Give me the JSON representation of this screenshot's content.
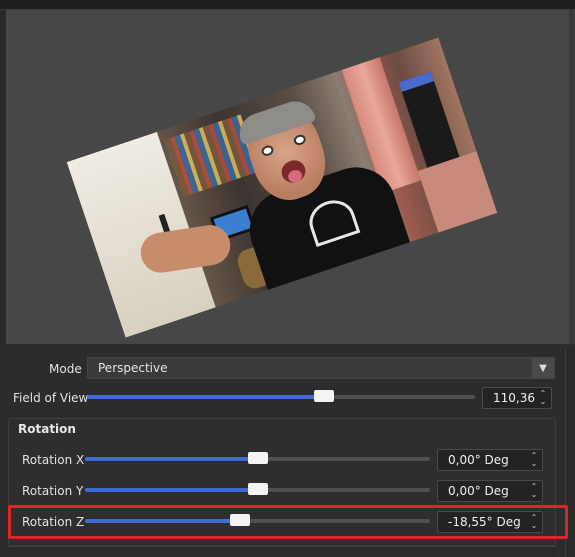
{
  "preview": {
    "image_rotation_deg": -18.55
  },
  "mode": {
    "label": "Mode",
    "value": "Perspective"
  },
  "fov": {
    "label": "Field of View",
    "value": "110,36",
    "fraction": 0.61
  },
  "rotation": {
    "title": "Rotation",
    "x": {
      "label": "Rotation X",
      "value": "0,00° Deg",
      "fraction": 0.5
    },
    "y": {
      "label": "Rotation Y",
      "value": "0,00° Deg",
      "fraction": 0.5
    },
    "z": {
      "label": "Rotation Z",
      "value": "-18,55° Deg",
      "fraction": 0.448
    }
  },
  "colors": {
    "slider_fill": "#3d6ad6",
    "highlight": "#d8262c"
  }
}
